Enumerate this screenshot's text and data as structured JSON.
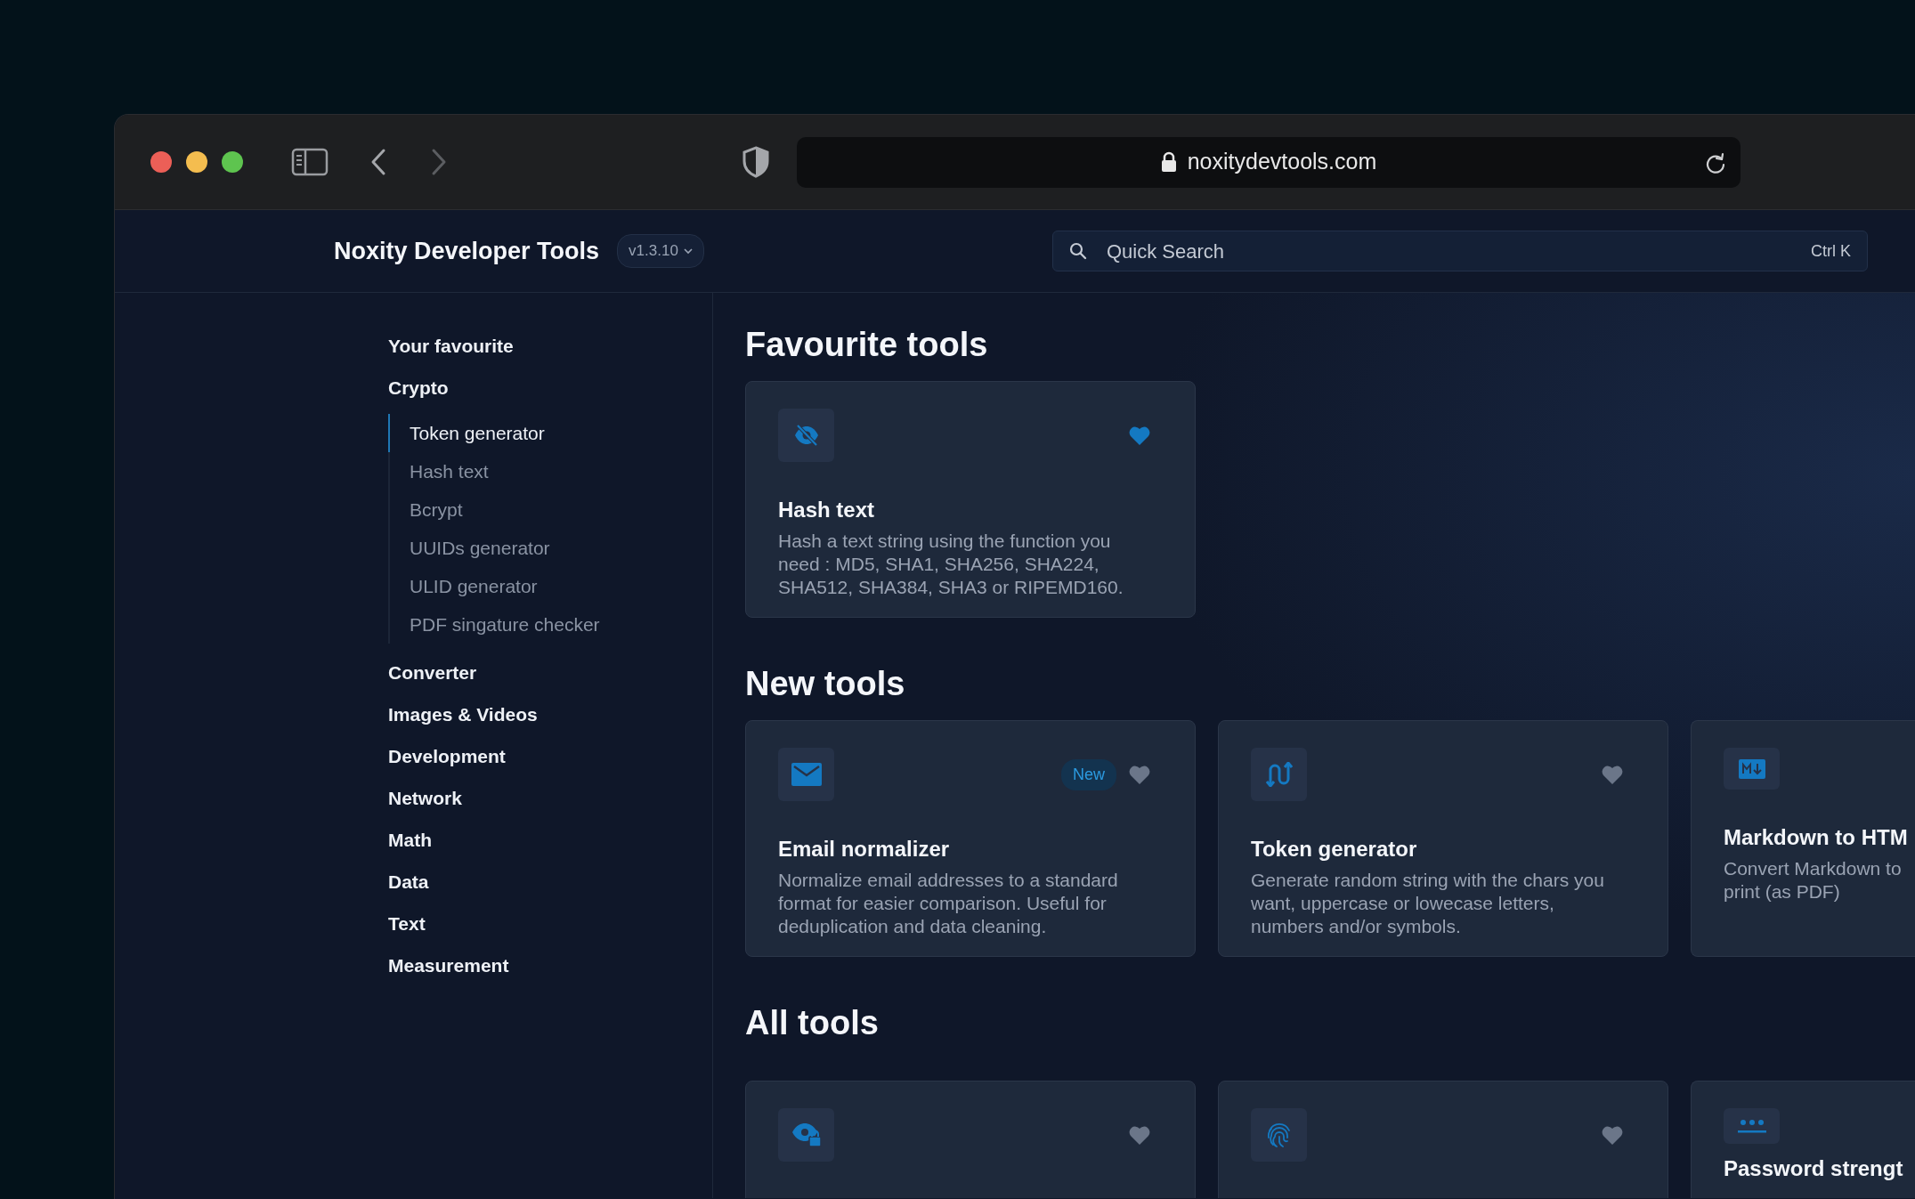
{
  "browser": {
    "url": "noxitydevtools.com"
  },
  "app": {
    "title": "Noxity Developer Tools",
    "version": "v1.3.10",
    "search": {
      "placeholder": "Quick Search",
      "shortcut": "Ctrl K"
    }
  },
  "sidebar": {
    "items": [
      {
        "label": "Your favourite"
      },
      {
        "label": "Crypto",
        "children": [
          {
            "label": "Token generator",
            "selected": true
          },
          {
            "label": "Hash text",
            "selected": false
          },
          {
            "label": "Bcrypt",
            "selected": false
          },
          {
            "label": "UUIDs generator",
            "selected": false
          },
          {
            "label": "ULID generator",
            "selected": false
          },
          {
            "label": "PDF singature checker",
            "selected": false
          }
        ]
      },
      {
        "label": "Converter"
      },
      {
        "label": "Images & Videos"
      },
      {
        "label": "Development"
      },
      {
        "label": "Network"
      },
      {
        "label": "Math"
      },
      {
        "label": "Data"
      },
      {
        "label": "Text"
      },
      {
        "label": "Measurement"
      }
    ]
  },
  "sections": [
    {
      "title": "Favourite tools",
      "cards": [
        {
          "kind": "eye-slash",
          "favourite": true,
          "title": "Hash text",
          "description": "Hash a text string using the function you need : MD5, SHA1, SHA256, SHA224, SHA512, SHA384, SHA3 or RIPEMD160."
        }
      ]
    },
    {
      "title": "New tools",
      "cards": [
        {
          "kind": "envelope",
          "favourite": false,
          "badge": "New",
          "title": "Email normalizer",
          "description": "Normalize email addresses to a standard format for easier comparison. Useful for deduplication and data cleaning."
        },
        {
          "kind": "arrows",
          "favourite": false,
          "title": "Token generator",
          "description": "Generate random string with the chars you want, uppercase or lowecase letters, numbers and/or symbols."
        },
        {
          "kind": "markdown",
          "title": "Markdown to HTM",
          "description_lines": [
            "Convert Markdown to",
            "print (as PDF)"
          ]
        }
      ]
    },
    {
      "title": "All tools",
      "cards": [
        {
          "kind": "eye-lock",
          "favourite": false
        },
        {
          "kind": "fingerprint",
          "favourite": false
        },
        {
          "kind": "dots",
          "title": "Password strengt"
        }
      ]
    }
  ]
}
